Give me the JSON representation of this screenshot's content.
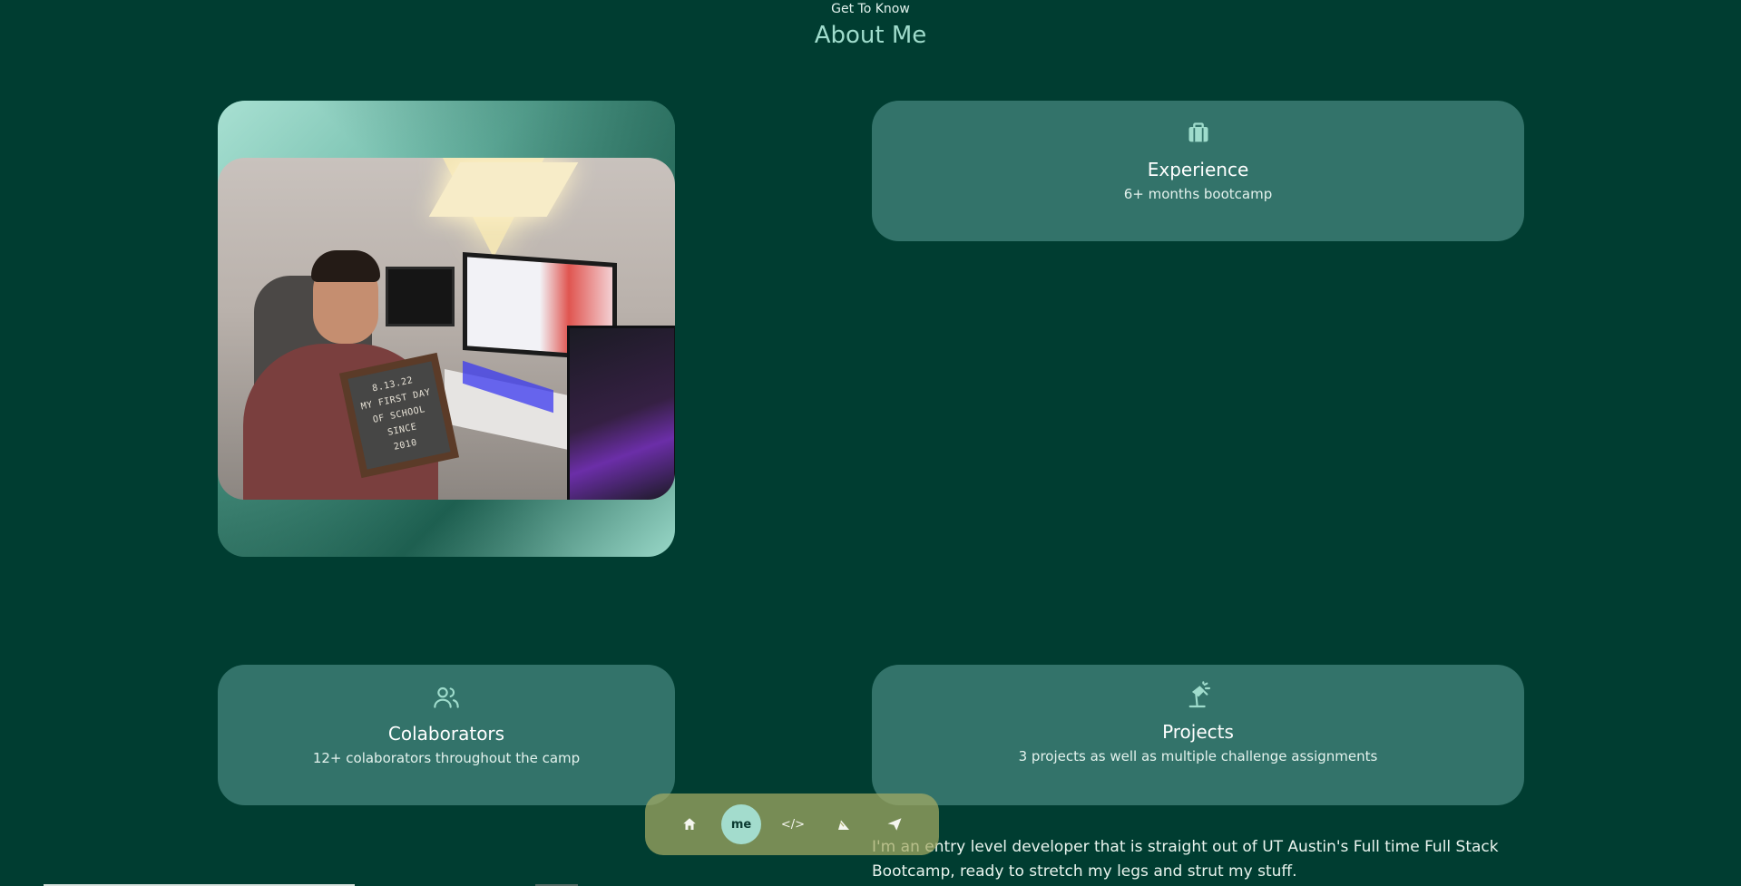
{
  "header": {
    "subtitle": "Get To Know",
    "title": "About Me"
  },
  "photo": {
    "letter_board": [
      "8.13.22",
      "MY FIRST DAY",
      "OF SCHOOL",
      "SINCE",
      "2010"
    ]
  },
  "cards": {
    "experience": {
      "icon": "briefcase-icon",
      "title": "Experience",
      "text": "6+ months bootcamp"
    },
    "colaborators": {
      "icon": "users-icon",
      "title": "Colaborators",
      "text": "12+ colaborators throughout the camp"
    },
    "projects": {
      "icon": "desk-lamp-icon",
      "title": "Projects",
      "text": "3 projects as well as multiple challenge assignments"
    }
  },
  "bio": "I'm an entry level developer that is straight out of UT Austin's Full time Full Stack Bootcamp, ready to stretch my legs and strut my stuff.",
  "nav": {
    "items": [
      {
        "name": "home-icon",
        "label": ""
      },
      {
        "name": "me",
        "label": "me"
      },
      {
        "name": "code-icon",
        "label": "</>"
      },
      {
        "name": "tools-icon",
        "label": ""
      },
      {
        "name": "send-icon",
        "label": ""
      }
    ]
  },
  "colors": {
    "background": "#003d31",
    "card": "#33736a",
    "accent": "#a3dccd",
    "nav": "#a5aa64"
  }
}
